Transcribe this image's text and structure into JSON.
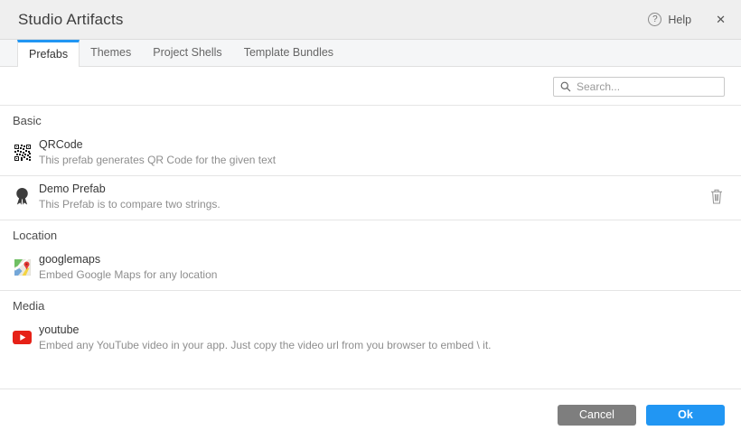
{
  "colors": {
    "accent_blue": "#2196f3",
    "cancel_gray": "#7e7e7e",
    "youtube_red": "#e62117",
    "header_bg": "#efefef"
  },
  "header": {
    "title": "Studio Artifacts",
    "help_glyph": "?",
    "help_label": "Help",
    "close_glyph": "✕"
  },
  "tabs": [
    {
      "label": "Prefabs",
      "active": true
    },
    {
      "label": "Themes",
      "active": false
    },
    {
      "label": "Project Shells",
      "active": false
    },
    {
      "label": "Template Bundles",
      "active": false
    }
  ],
  "search": {
    "placeholder": "Search...",
    "value": ""
  },
  "sections": [
    {
      "title": "Basic",
      "items": [
        {
          "icon": "qrcode-icon",
          "name": "QRCode",
          "description": "This prefab generates QR Code for the given text",
          "deletable": false
        },
        {
          "icon": "ribbon-badge-icon",
          "name": "Demo Prefab",
          "description": "This Prefab is to compare two strings.",
          "deletable": true
        }
      ]
    },
    {
      "title": "Location",
      "items": [
        {
          "icon": "google-maps-icon",
          "name": "googlemaps",
          "description": "Embed Google Maps for any location",
          "deletable": false
        }
      ]
    },
    {
      "title": "Media",
      "items": [
        {
          "icon": "youtube-icon",
          "name": "youtube",
          "description": "Embed any YouTube video in your app. Just copy the video url from you browser to embed \\ it.",
          "deletable": false
        }
      ]
    }
  ],
  "footer": {
    "cancel_label": "Cancel",
    "ok_label": "Ok"
  }
}
